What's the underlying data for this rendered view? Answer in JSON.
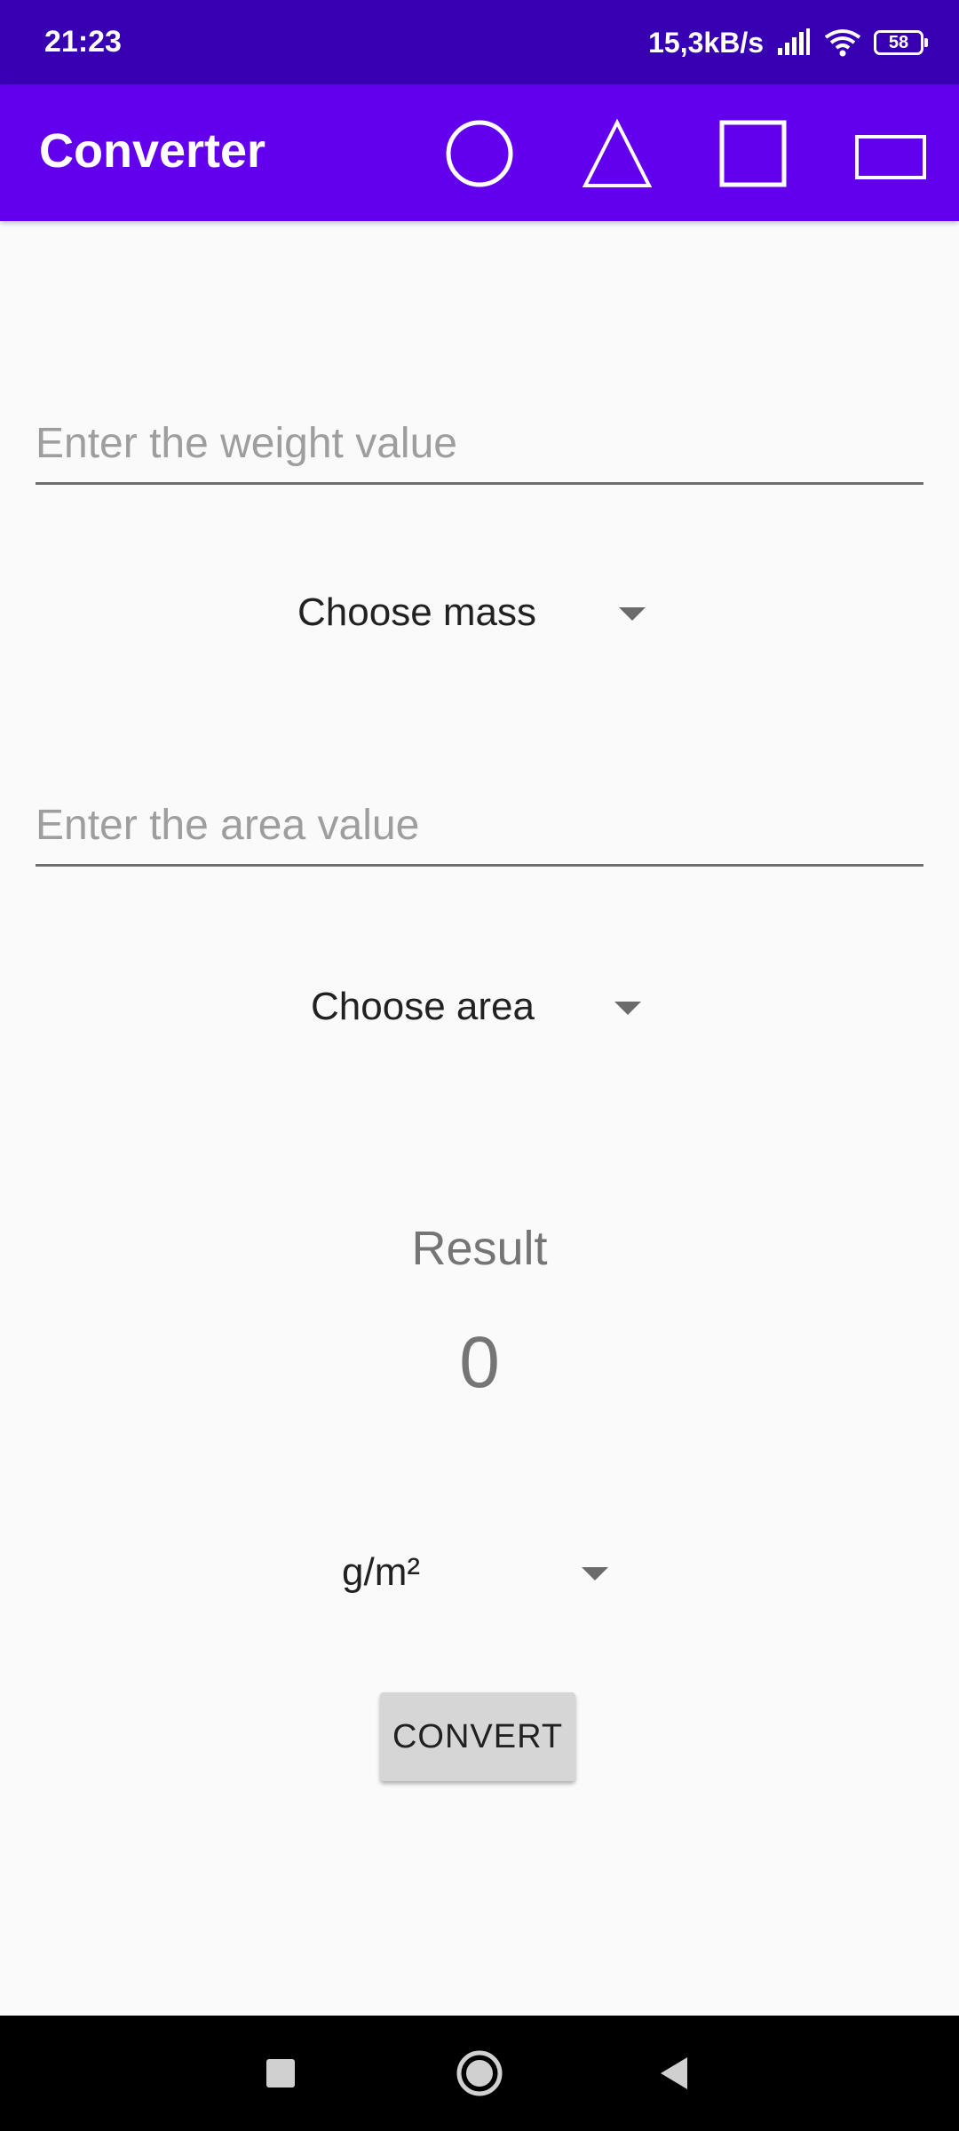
{
  "status_bar": {
    "time": "21:23",
    "net_speed": "15,3kB/s",
    "battery": "58"
  },
  "app_bar": {
    "title": "Converter",
    "actions": [
      "circle-icon",
      "triangle-icon",
      "square-icon",
      "rectangle-icon"
    ]
  },
  "weight_field": {
    "value": "",
    "placeholder": "Enter the weight value"
  },
  "mass_spinner": {
    "selected": "Choose mass"
  },
  "area_field": {
    "value": "",
    "placeholder": "Enter the area value"
  },
  "area_spinner": {
    "selected": "Choose area"
  },
  "result": {
    "title": "Result",
    "value": "0"
  },
  "unit_spinner": {
    "selected": "g/m²"
  },
  "convert_button": {
    "label": "CONVERT"
  },
  "colors": {
    "status_bar": "#3700b3",
    "app_bar": "#6200ee",
    "background": "#fafafa",
    "button": "#d6d6d6"
  }
}
